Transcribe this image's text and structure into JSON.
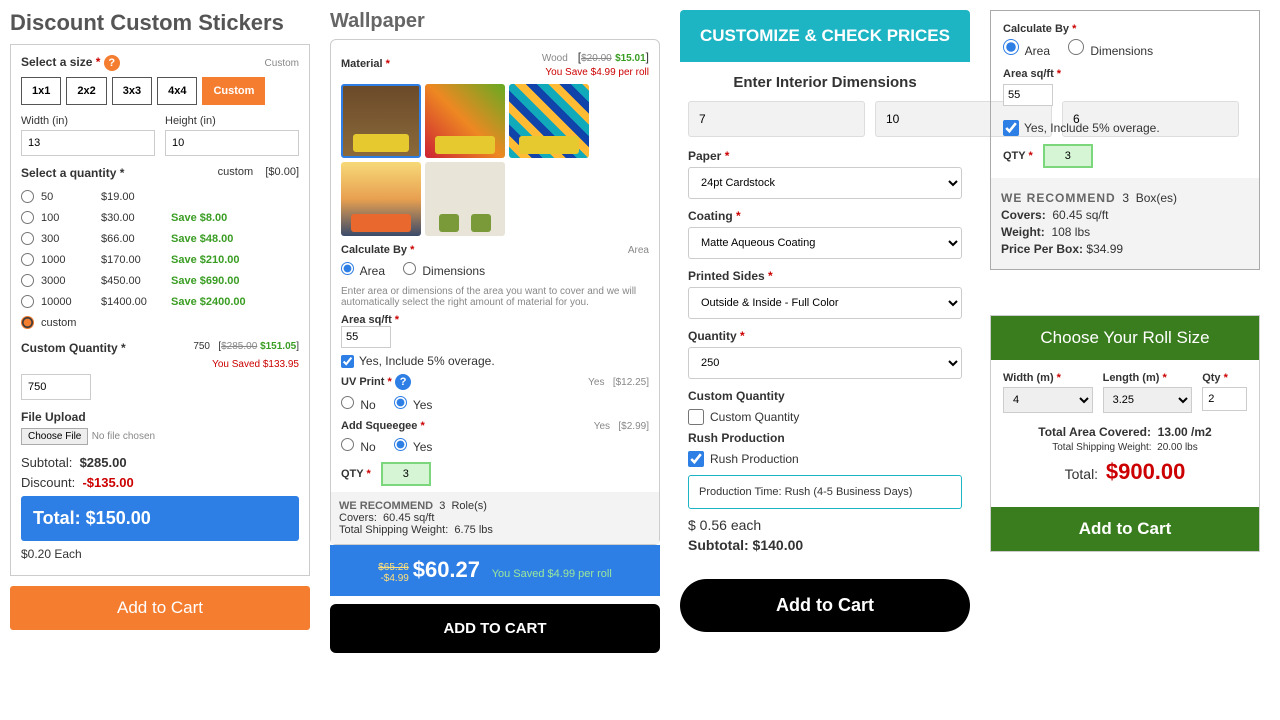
{
  "stickers": {
    "title": "Discount Custom Stickers",
    "size_label": "Select a size",
    "size_label_right": "Custom",
    "sizes": [
      "1x1",
      "2x2",
      "3x3",
      "4x4",
      "Custom"
    ],
    "width_label": "Width (in)",
    "height_label": "Height (in)",
    "width": "13",
    "height": "10",
    "qty_label": "Select a quantity *",
    "qty_right_l": "custom",
    "qty_right_r": "[$0.00]",
    "rows": [
      {
        "q": "50",
        "p": "$19.00",
        "s": ""
      },
      {
        "q": "100",
        "p": "$30.00",
        "s": "Save $8.00"
      },
      {
        "q": "300",
        "p": "$66.00",
        "s": "Save $48.00"
      },
      {
        "q": "1000",
        "p": "$170.00",
        "s": "Save $210.00"
      },
      {
        "q": "3000",
        "p": "$450.00",
        "s": "Save $690.00"
      },
      {
        "q": "10000",
        "p": "$1400.00",
        "s": "Save $2400.00"
      },
      {
        "q": "custom",
        "p": "",
        "s": ""
      }
    ],
    "custom_qty_label": "Custom Quantity *",
    "cq_750": "750",
    "cq_strike": "$285.00",
    "cq_price": "$151.05",
    "cq_saved": "You Saved $133.95",
    "cq_value": "750",
    "file_label": "File Upload",
    "file_btn": "Choose File",
    "file_none": "No file chosen",
    "subtotal_l": "Subtotal:",
    "subtotal_v": "$285.00",
    "discount_l": "Discount:",
    "discount_v": "-$135.00",
    "total_l": "Total:",
    "total_v": "$150.00",
    "each": "$0.20  Each",
    "cart": "Add to Cart"
  },
  "wallpaper": {
    "title": "Wallpaper",
    "material_label": "Material",
    "material_sel": "Wood",
    "old_price": "$20.00",
    "new_price": "$15.01",
    "save_roll": "You Save $4.99 per roll",
    "calc_label": "Calculate By",
    "calc_right": "Area",
    "opt_area": "Area",
    "opt_dim": "Dimensions",
    "hint": "Enter area or dimensions of the area you want to cover and we will automatically select the right amount of material for you.",
    "area_label": "Area sq/ft",
    "area_val": "55",
    "overage": "Yes, Include 5% overage.",
    "uv_label": "UV Print",
    "uv_right_l": "Yes",
    "uv_right_r": "[$12.25]",
    "sq_label": "Add Squeegee",
    "sq_right_l": "Yes",
    "sq_right_r": "[$2.99]",
    "no": "No",
    "yes": "Yes",
    "qty_label": "QTY",
    "qty_val": "3",
    "rec": "WE RECOMMEND",
    "rec_n": "3",
    "rec_unit": "Role(s)",
    "covers_l": "Covers:",
    "covers_v": "60.45  sq/ft",
    "ship_l": "Total Shipping Weight:",
    "ship_v": "6.75  lbs",
    "p_old": "$65.26",
    "p_minus": "-$4.99",
    "p_main": "$60.27",
    "p_saved": "You Saved  $4.99  per roll",
    "cart": "ADD TO CART"
  },
  "customize": {
    "header": "CUSTOMIZE & CHECK PRICES",
    "dims_title": "Enter Interior Dimensions",
    "d1": "7",
    "d2": "10",
    "d3": "6",
    "paper_l": "Paper",
    "paper_v": "24pt Cardstock",
    "coating_l": "Coating",
    "coating_v": "Matte Aqueous Coating",
    "sides_l": "Printed Sides",
    "sides_v": "Outside & Inside - Full Color",
    "qty_l": "Quantity",
    "qty_v": "250",
    "custq_l": "Custom Quantity",
    "custq_chk": "Custom Quantity",
    "rush_l": "Rush Production",
    "rush_chk": "Rush Production",
    "rush_msg": "Production Time: Rush (4-5 Business Days)",
    "each_l": "$  0.56  each",
    "subtotal": "Subtotal: $140.00",
    "cart": "Add to Cart"
  },
  "calc4": {
    "calc_label": "Calculate By",
    "opt_area": "Area",
    "opt_dim": "Dimensions",
    "area_label": "Area sq/ft",
    "area_val": "55",
    "overage": "Yes, Include 5% overage.",
    "qty_label": "QTY",
    "qty_val": "3",
    "rec": "WE RECOMMEND",
    "rec_n": "3",
    "rec_unit": "Box(es)",
    "covers_l": "Covers:",
    "covers_v": "60.45  sq/ft",
    "weight_l": "Weight:",
    "weight_v": "108  lbs",
    "ppb_l": "Price Per Box:",
    "ppb_v": "$34.99"
  },
  "roll": {
    "header": "Choose Your Roll Size",
    "width_l": "Width (m)",
    "length_l": "Length (m)",
    "qty_l": "Qty",
    "width_v": "4",
    "length_v": "3.25",
    "qty_v": "2",
    "area_l": "Total Area Covered:",
    "area_v": "13.00  /m2",
    "ship_l": "Total Shipping Weight:",
    "ship_v": "20.00  lbs",
    "total_l": "Total:",
    "total_v": "$900.00",
    "cart": "Add to Cart"
  }
}
